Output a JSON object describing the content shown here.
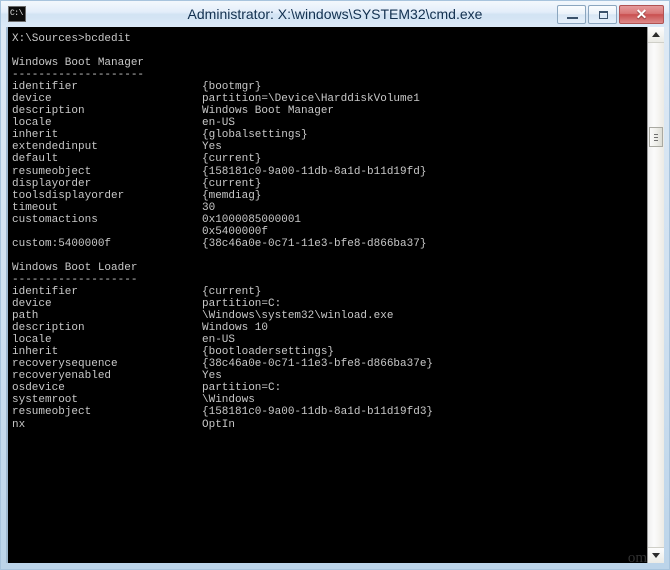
{
  "window": {
    "title": "Administrator: X:\\windows\\SYSTEM32\\cmd.exe",
    "icon_label": "C:\\",
    "icon_name": "cmd-console-icon",
    "buttons": {
      "minimize": "—",
      "maximize": "□",
      "close": "✕"
    }
  },
  "console": {
    "prompt_line": "X:\\Sources>bcdedit",
    "sections": [
      {
        "heading": "Windows Boot Manager",
        "rule": "--------------------",
        "entries": [
          {
            "name": "identifier",
            "value": "{bootmgr}"
          },
          {
            "name": "device",
            "value": "partition=\\Device\\HarddiskVolume1"
          },
          {
            "name": "description",
            "value": "Windows Boot Manager"
          },
          {
            "name": "locale",
            "value": "en-US"
          },
          {
            "name": "inherit",
            "value": "{globalsettings}"
          },
          {
            "name": "extendedinput",
            "value": "Yes"
          },
          {
            "name": "default",
            "value": "{current}"
          },
          {
            "name": "resumeobject",
            "value": "{158181c0-9a00-11db-8a1d-b11d19fd}"
          },
          {
            "name": "displayorder",
            "value": "{current}"
          },
          {
            "name": "toolsdisplayorder",
            "value": "{memdiag}"
          },
          {
            "name": "timeout",
            "value": "30"
          },
          {
            "name": "customactions",
            "value": "0x1000085000001"
          },
          {
            "name": "",
            "value": "0x5400000f"
          },
          {
            "name": "custom:5400000f",
            "value": "{38c46a0e-0c71-11e3-bfe8-d866ba37}"
          }
        ]
      },
      {
        "heading": "Windows Boot Loader",
        "rule": "-------------------",
        "entries": [
          {
            "name": "identifier",
            "value": "{current}"
          },
          {
            "name": "device",
            "value": "partition=C:"
          },
          {
            "name": "path",
            "value": "\\Windows\\system32\\winload.exe"
          },
          {
            "name": "description",
            "value": "Windows 10"
          },
          {
            "name": "locale",
            "value": "en-US"
          },
          {
            "name": "inherit",
            "value": "{bootloadersettings}"
          },
          {
            "name": "recoverysequence",
            "value": "{38c46a0e-0c71-11e3-bfe8-d866ba37e}"
          },
          {
            "name": "recoveryenabled",
            "value": "Yes"
          },
          {
            "name": "osdevice",
            "value": "partition=C:"
          },
          {
            "name": "systemroot",
            "value": "\\Windows"
          },
          {
            "name": "resumeobject",
            "value": "{158181c0-9a00-11db-8a1d-b11d19fd3}"
          },
          {
            "name": "nx",
            "value": "OptIn"
          }
        ]
      }
    ]
  },
  "scrollbar": {
    "up_arrow": "scroll-up-arrow",
    "down_arrow": "scroll-down-arrow",
    "thumb": "scroll-thumb"
  },
  "watermark": {
    "text": "om"
  },
  "colors": {
    "console_bg": "#000000",
    "console_fg": "#c8c8c8",
    "titlebar_text": "#12304f",
    "close_button": "#c94f4f"
  }
}
